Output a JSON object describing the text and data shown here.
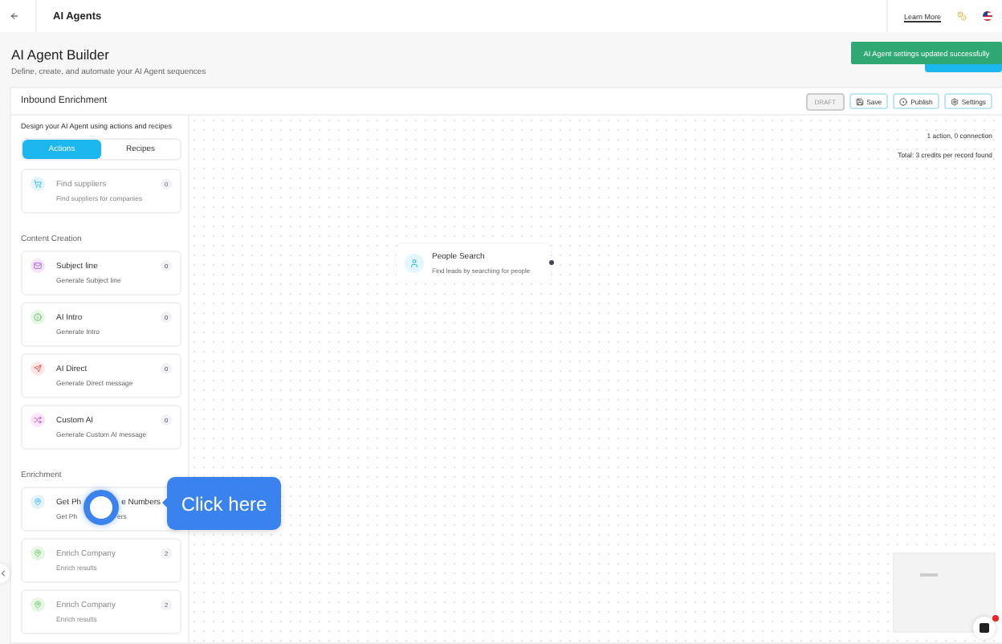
{
  "header": {
    "title": "AI Agents",
    "learn_more": "Learn More"
  },
  "page": {
    "title": "AI Agent Builder",
    "subtitle": "Define, create, and automate your AI Agent sequences"
  },
  "toast": {
    "message": "AI Agent settings updated successfully"
  },
  "builder": {
    "name": "Inbound Enrichment",
    "status": "DRAFT",
    "buttons": [
      {
        "kind": "save",
        "label": "Save"
      },
      {
        "kind": "publish",
        "label": "Publish"
      },
      {
        "kind": "settings",
        "label": "Settings"
      }
    ]
  },
  "sidebar": {
    "intro": "Design your AI Agent using actions and recipes",
    "tabs": [
      {
        "label": "Actions",
        "selected": true
      },
      {
        "label": "Recipes",
        "selected": false
      }
    ],
    "groups": [
      {
        "items": [
          {
            "title": "Find suppliers",
            "description": "Find suppliers for companies",
            "count": "0",
            "disabled": true,
            "color": "#e3f4fb"
          }
        ]
      },
      {
        "heading": "Content Creation",
        "items": [
          {
            "title": "Subject line",
            "description": "Generate Subject line",
            "count": "0",
            "disabled": false,
            "color": "#f1e4fb"
          },
          {
            "title": "AI Intro",
            "description": "Generate Intro",
            "count": "0",
            "disabled": false,
            "color": "#e6f7e4"
          },
          {
            "title": "AI Direct",
            "description": "Generate Direct message",
            "count": "0",
            "disabled": false,
            "color": "#fde6e6"
          },
          {
            "title": "Custom AI",
            "description": "Generate Custom AI message",
            "count": "0",
            "disabled": false,
            "color": "#fbe4f7"
          }
        ]
      },
      {
        "heading": "Enrichment",
        "items": [
          {
            "title_parts": [
              "Get Ph",
              "e Numbers"
            ],
            "description_parts": [
              "Get Ph",
              "ers"
            ],
            "disabled": false,
            "color": "#e3f4fb"
          },
          {
            "title": "Enrich Company",
            "description": "Enrich results",
            "count": "2",
            "disabled": true,
            "color": "#e6f7e4"
          },
          {
            "title": "Enrich Company",
            "description": "Enrich results",
            "count": "2",
            "disabled": true,
            "color": "#e6f7e4"
          }
        ]
      }
    ]
  },
  "canvas": {
    "stats": [
      "1 action, 0 connection",
      "Total: 3 credits per record found"
    ],
    "nodes": [
      {
        "title": "People Search",
        "description": "Find leads by searching for people"
      }
    ]
  },
  "tour": {
    "tooltip": "Click here"
  }
}
